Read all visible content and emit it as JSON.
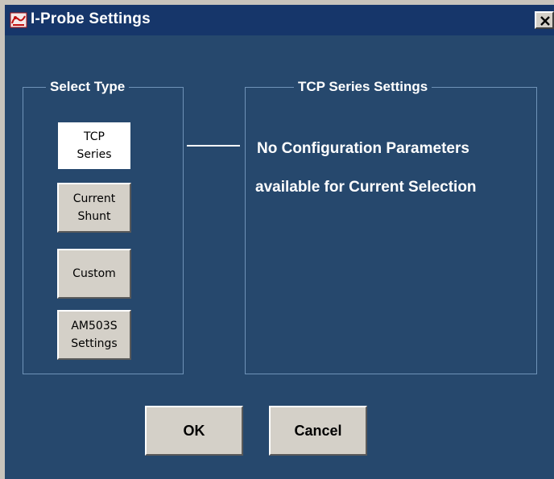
{
  "window": {
    "title": "I-Probe Settings",
    "icon": "probe-app-icon",
    "close_icon": "close-icon"
  },
  "select_type": {
    "legend": "Select Type",
    "buttons": [
      {
        "line1": "TCP",
        "line2": "Series",
        "selected": true
      },
      {
        "line1": "Current",
        "line2": "Shunt",
        "selected": false
      },
      {
        "line1": "Custom",
        "line2": "",
        "selected": false
      },
      {
        "line1": "AM503S",
        "line2": "Settings",
        "selected": false
      }
    ]
  },
  "settings_panel": {
    "legend": "TCP Series Settings",
    "message_line1": "No Configuration Parameters",
    "message_line2": "available for Current Selection"
  },
  "footer": {
    "ok_label": "OK",
    "cancel_label": "Cancel"
  },
  "colors": {
    "background": "#26486d",
    "titlebar": "#16366a",
    "button_face": "#d4d0c8",
    "text_light": "#ffffff"
  }
}
